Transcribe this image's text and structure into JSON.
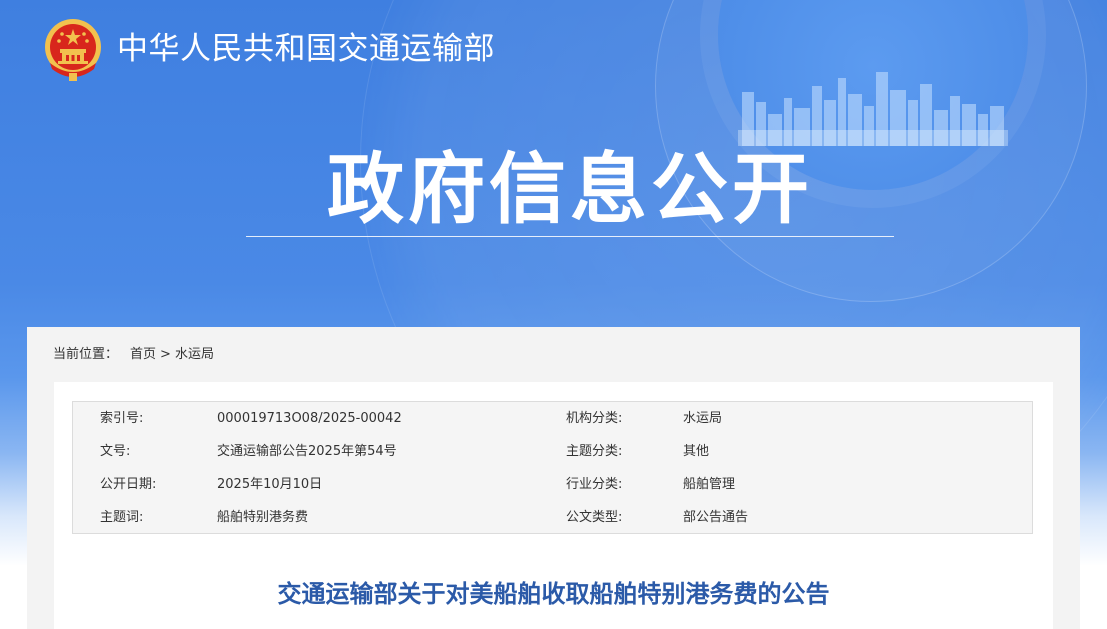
{
  "header": {
    "site_name": "中华人民共和国交通运输部",
    "section_title": "政府信息公开"
  },
  "breadcrumb": {
    "label": "当前位置：",
    "items": [
      "首页",
      "水运局"
    ],
    "separator": ">"
  },
  "meta": {
    "left": [
      {
        "label": "索引号:",
        "value": "000019713O08/2025-00042"
      },
      {
        "label": "文号:",
        "value": "交通运输部公告2025年第54号"
      },
      {
        "label": "公开日期:",
        "value": "2025年10月10日"
      },
      {
        "label": "主题词:",
        "value": "船舶特别港务费"
      }
    ],
    "right": [
      {
        "label": "机构分类:",
        "value": "水运局"
      },
      {
        "label": "主题分类:",
        "value": "其他"
      },
      {
        "label": "行业分类:",
        "value": "船舶管理"
      },
      {
        "label": "公文类型:",
        "value": "部公告通告"
      }
    ]
  },
  "document": {
    "title": "交通运输部关于对美船舶收取船舶特别港务费的公告"
  },
  "colors": {
    "banner_blue": "#4a89e6",
    "title_blue": "#2b5aa8",
    "emblem_red": "#d8261c",
    "emblem_gold": "#f2c14e"
  },
  "icons": {
    "logo": "national-emblem-icon"
  }
}
